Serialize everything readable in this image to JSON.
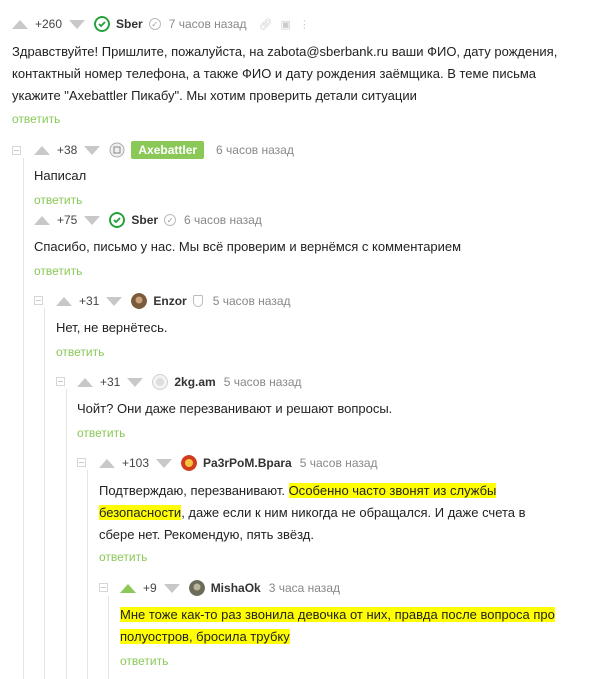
{
  "comments": [
    {
      "votes": "+260",
      "author": "Sber",
      "time": "7 часов назад",
      "text": "Здравствуйте! Пришлите, пожалуйста, на zabota@sberbank.ru ваши ФИО, дату рождения, контактный номер телефона, а также ФИО и дату рождения заёмщика. В теме письма укажите \"Axebattler Пикабу\". Мы хотим проверить детали ситуации",
      "reply": "ответить"
    },
    {
      "votes": "+38",
      "author": "Axebattler",
      "time": "6 часов назад",
      "text": "Написал",
      "reply": "ответить"
    },
    {
      "votes": "+75",
      "author": "Sber",
      "time": "6 часов назад",
      "text": "Спасибо, письмо у нас. Мы всё проверим и вернёмся с комментарием",
      "reply": "ответить"
    },
    {
      "votes": "+31",
      "author": "Enzor",
      "time": "5 часов назад",
      "text": "Нет, не вернётесь.",
      "reply": "ответить"
    },
    {
      "votes": "+31",
      "author": "2kg.am",
      "time": "5 часов назад",
      "text": "Чойт? Они даже перезванивают и решают вопросы.",
      "reply": "ответить"
    },
    {
      "votes": "+103",
      "author": "Pa3rPoM.Bpara",
      "time": "5 часов назад",
      "text_before": "Подтверждаю, перезванивают. ",
      "text_highlight": "Особенно часто звонят из службы безопасности",
      "text_after": ", даже если к ним никогда не обращался. И даже счета в сбере нет. Рекомендую, пять звёзд.",
      "reply": "ответить"
    },
    {
      "votes": "+9",
      "author": "MishaOk",
      "time": "3 часа назад",
      "text": "Мне тоже как-то раз звонила девочка от них, правда после вопроса про полуостров, бросила трубку",
      "reply": "ответить"
    }
  ],
  "colors": {
    "accent": "#8ac858",
    "highlight": "#ffff00",
    "muted": "#888888"
  }
}
